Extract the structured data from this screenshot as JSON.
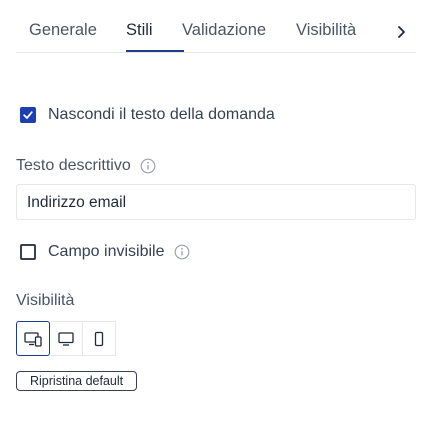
{
  "tabs": [
    {
      "label": "Generale"
    },
    {
      "label": "Stili"
    },
    {
      "label": "Validazione"
    },
    {
      "label": "Visibilità"
    }
  ],
  "active_tab": "Stili",
  "hide_question_text": {
    "label": "Nascondi il testo della domanda",
    "checked": true
  },
  "description": {
    "label": "Testo descrittivo",
    "value": "Indirizzo email"
  },
  "invisible_field": {
    "label": "Campo invisibile",
    "checked": false
  },
  "visibility": {
    "label": "Visibilità",
    "devices": [
      {
        "icon": "desktop-mobile-icon",
        "active": true
      },
      {
        "icon": "desktop-icon",
        "active": false
      },
      {
        "icon": "mobile-icon",
        "active": false
      }
    ]
  },
  "reset_label": "Ripristina default",
  "colors": {
    "accent": "#1e40af",
    "text": "#374151",
    "border": "#e5e7eb"
  }
}
